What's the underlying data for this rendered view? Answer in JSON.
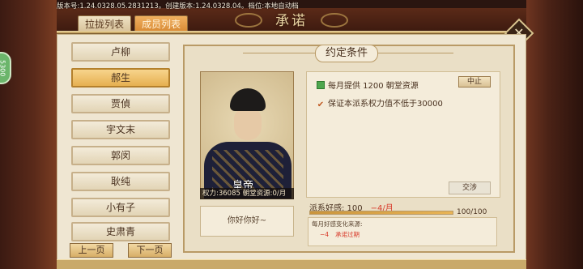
{
  "version_text": "版本号:1.24.0328.05.2831213。创建版本:1.24.0328.04。档位:本地自动档",
  "side_badge": "5300",
  "tabs": [
    "拉拢列表",
    "成员列表"
  ],
  "title": "承诺",
  "section_title": "约定条件",
  "members": [
    "卢柳",
    "郝生",
    "贾偵",
    "宇文末",
    "郭闵",
    "耿纯",
    "小有子",
    "史肃青"
  ],
  "selected_member_index": 1,
  "pager": {
    "prev": "上一页",
    "next": "下一页"
  },
  "character": {
    "name": "皇帝",
    "stats": "权力:36085   朝堂资源:0/月",
    "greeting": "你好你好~"
  },
  "terms": [
    {
      "text": "每月提供 1200 朝堂资源",
      "marker": "square",
      "marker_color": "#4ea64e",
      "action": "中止"
    },
    {
      "text": "保证本派系权力值不低于30000",
      "marker": "check",
      "marker_color": "#c05a22"
    }
  ],
  "negotiate_label": "交涉",
  "affinity": {
    "label": "派系好感: 100",
    "delta": "−4/月",
    "value": 100,
    "max": 100,
    "max_text": "100/100"
  },
  "monthly_change": {
    "title": "每月好感变化来源:",
    "entries": [
      {
        "amount": "−4",
        "reason": "承诺过期"
      }
    ]
  }
}
